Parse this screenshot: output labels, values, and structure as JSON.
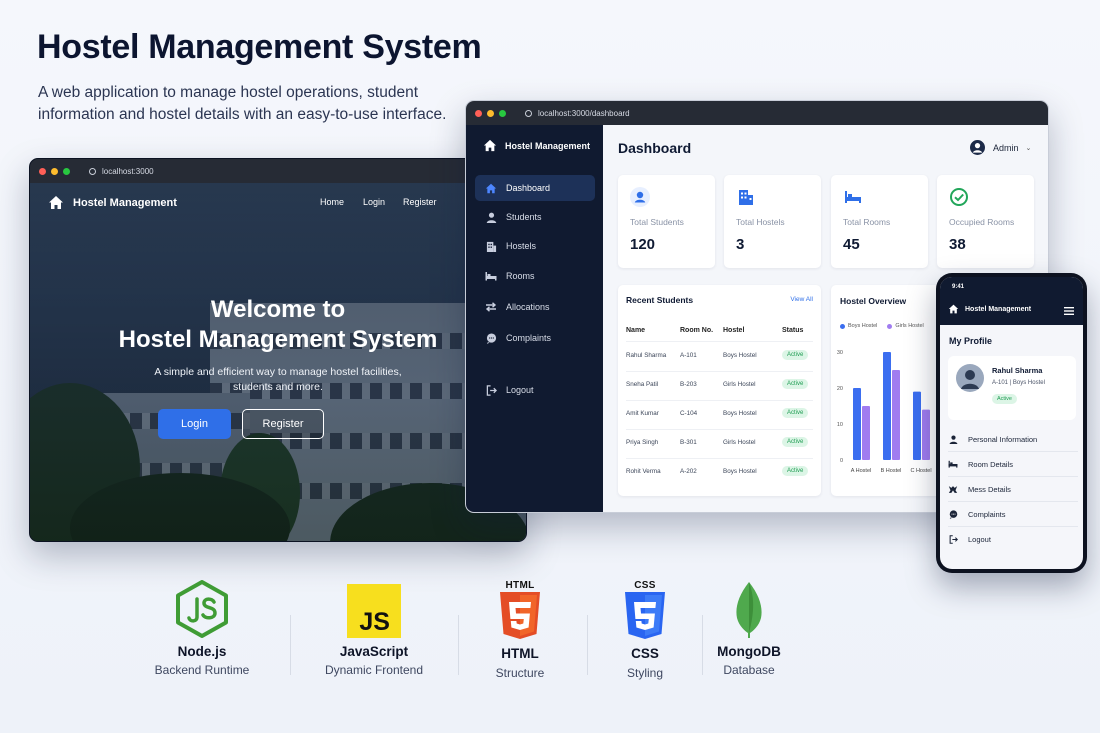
{
  "header": {
    "title": "Hostel Management System",
    "subtitle": "A web application to manage hostel operations, student information and hostel details with an easy-to-use interface."
  },
  "landing": {
    "url": "localhost:3000",
    "brand": "Hostel Management",
    "nav": [
      "Home",
      "Login",
      "Register"
    ],
    "heading_line1": "Welcome to",
    "heading_line2": "Hostel Management System",
    "tagline_line1": "A simple and efficient way to manage hostel facilities,",
    "tagline_line2": "students and more.",
    "login_label": "Login",
    "register_label": "Register"
  },
  "dashboard": {
    "url": "localhost:3000/dashboard",
    "brand": "Hostel Management",
    "page_title": "Dashboard",
    "user": "Admin",
    "sidebar": [
      {
        "label": "Dashboard",
        "icon": "home-icon"
      },
      {
        "label": "Students",
        "icon": "user-icon"
      },
      {
        "label": "Hostels",
        "icon": "building-icon"
      },
      {
        "label": "Rooms",
        "icon": "bed-icon"
      },
      {
        "label": "Allocations",
        "icon": "swap-icon"
      },
      {
        "label": "Complaints",
        "icon": "chat-icon"
      }
    ],
    "logout_label": "Logout",
    "stats": [
      {
        "label": "Total Students",
        "value": "120",
        "icon": "user-icon",
        "color": "#2f6fe8"
      },
      {
        "label": "Total Hostels",
        "value": "3",
        "icon": "building-icon",
        "color": "#2f6fe8"
      },
      {
        "label": "Total Rooms",
        "value": "45",
        "icon": "bed-icon",
        "color": "#2f6fe8"
      },
      {
        "label": "Occupied Rooms",
        "value": "38",
        "icon": "check-circle-icon",
        "color": "#22a65a"
      }
    ],
    "recent": {
      "title": "Recent Students",
      "view_all": "View All",
      "columns": [
        "Name",
        "Room No.",
        "Hostel",
        "Status"
      ],
      "rows": [
        [
          "Rahul Sharma",
          "A-101",
          "Boys Hostel",
          "Active"
        ],
        [
          "Sneha Patil",
          "B-203",
          "Girls Hostel",
          "Active"
        ],
        [
          "Amit Kumar",
          "C-104",
          "Boys Hostel",
          "Active"
        ],
        [
          "Priya Singh",
          "B-301",
          "Girls Hostel",
          "Active"
        ],
        [
          "Rohit Verma",
          "A-202",
          "Boys Hostel",
          "Active"
        ]
      ]
    },
    "overview": {
      "title": "Hostel Overview",
      "legend": [
        "Boys Hostel",
        "Girls Hostel"
      ],
      "yticks": [
        "30",
        "20",
        "10",
        "0"
      ],
      "categories": [
        "A Hostel",
        "B Hostel",
        "C Hostel"
      ],
      "series": [
        {
          "name": "Boys Hostel",
          "values": [
            20,
            30,
            19
          ],
          "color": "#3b6ef0"
        },
        {
          "name": "Girls Hostel",
          "values": [
            15,
            25,
            14
          ],
          "color": "#a07cf0"
        }
      ]
    }
  },
  "phone": {
    "time": "9:41",
    "brand": "Hostel Management",
    "section_title": "My Profile",
    "name": "Rahul Sharma",
    "detail": "A-101 | Boys Hostel",
    "status": "Active",
    "menu": [
      {
        "label": "Personal Information",
        "icon": "user-icon"
      },
      {
        "label": "Room Details",
        "icon": "bed-icon"
      },
      {
        "label": "Mess Details",
        "icon": "utensils-icon"
      },
      {
        "label": "Complaints",
        "icon": "chat-icon"
      },
      {
        "label": "Logout",
        "icon": "logout-icon"
      }
    ]
  },
  "tech": [
    {
      "name": "Node.js",
      "desc": "Backend Runtime",
      "icon": "nodejs-icon",
      "color": "#3f9c35"
    },
    {
      "name": "JavaScript",
      "desc": "Dynamic Frontend",
      "icon": "javascript-icon",
      "color": "#f7df1e"
    },
    {
      "name": "HTML",
      "desc": "Structure",
      "icon": "html5-icon",
      "color": "#e44d26",
      "badge": "HTML"
    },
    {
      "name": "CSS",
      "desc": "Styling",
      "icon": "css3-icon",
      "color": "#2965f1",
      "badge": "CSS"
    },
    {
      "name": "MongoDB",
      "desc": "Database",
      "icon": "mongodb-icon",
      "color": "#4fa94d"
    }
  ],
  "colors": {
    "accent": "#2f6fe8",
    "sidebar": "#101a30",
    "success": "#1f9d53"
  }
}
